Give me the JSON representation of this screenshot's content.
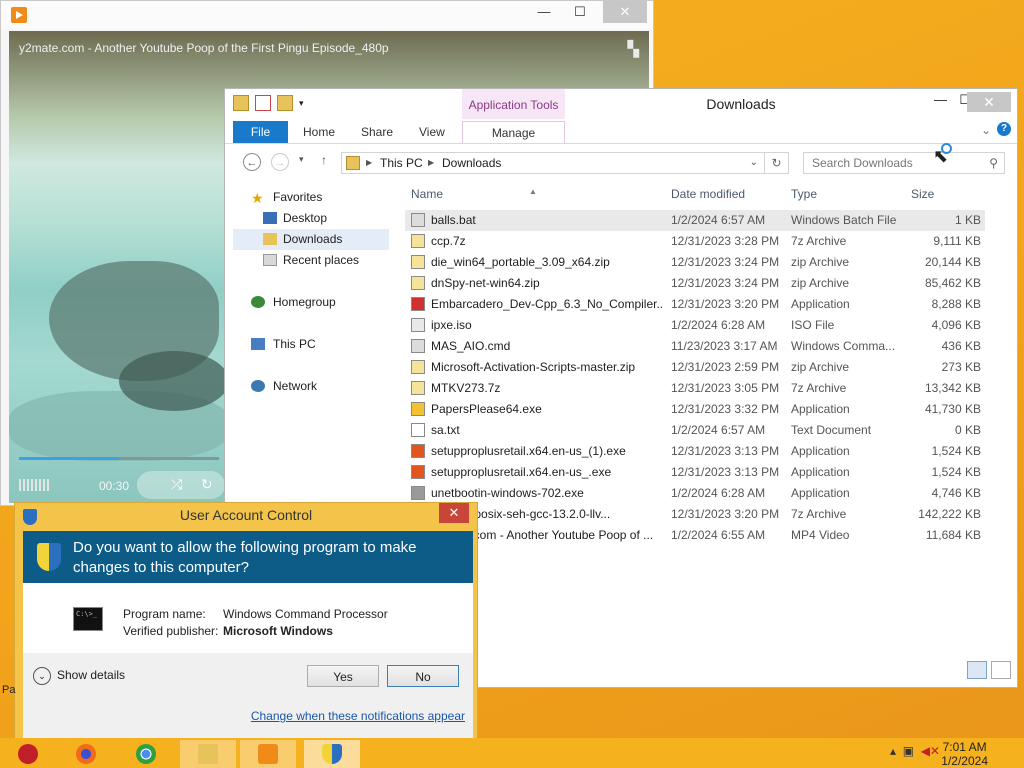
{
  "player": {
    "video_title": "y2mate.com - Another Youtube Poop of the First Pingu Episode_480p",
    "time": "00:30",
    "progress_fraction": 0.5,
    "close_label": "✕",
    "min_label": "—",
    "max_label": "☐"
  },
  "explorer": {
    "title": "Downloads",
    "context_tab": "Application Tools",
    "ribbon_tabs": [
      "File",
      "Home",
      "Share",
      "View",
      "Manage"
    ],
    "address": [
      "This PC",
      "Downloads"
    ],
    "search_placeholder": "Search Downloads",
    "nav": {
      "favorites": "Favorites",
      "desktop": "Desktop",
      "downloads": "Downloads",
      "recent": "Recent places",
      "homegroup": "Homegroup",
      "this_pc": "This PC",
      "network": "Network"
    },
    "columns": [
      "Name",
      "Date modified",
      "Type",
      "Size"
    ],
    "files": [
      {
        "name": "balls.bat",
        "date": "1/2/2024 6:57 AM",
        "type": "Windows Batch File",
        "size": "1 KB"
      },
      {
        "name": "ccp.7z",
        "date": "12/31/2023 3:28 PM",
        "type": "7z Archive",
        "size": "9,111 KB"
      },
      {
        "name": "die_win64_portable_3.09_x64.zip",
        "date": "12/31/2023 3:24 PM",
        "type": "zip Archive",
        "size": "20,144 KB"
      },
      {
        "name": "dnSpy-net-win64.zip",
        "date": "12/31/2023 3:24 PM",
        "type": "zip Archive",
        "size": "85,462 KB"
      },
      {
        "name": "Embarcadero_Dev-Cpp_6.3_No_Compiler...",
        "date": "12/31/2023 3:20 PM",
        "type": "Application",
        "size": "8,288 KB"
      },
      {
        "name": "ipxe.iso",
        "date": "1/2/2024 6:28 AM",
        "type": "ISO File",
        "size": "4,096 KB"
      },
      {
        "name": "MAS_AIO.cmd",
        "date": "11/23/2023 3:17 AM",
        "type": "Windows Comma...",
        "size": "436 KB"
      },
      {
        "name": "Microsoft-Activation-Scripts-master.zip",
        "date": "12/31/2023 2:59 PM",
        "type": "zip Archive",
        "size": "273 KB"
      },
      {
        "name": "MTKV273.7z",
        "date": "12/31/2023 3:05 PM",
        "type": "7z Archive",
        "size": "13,342 KB"
      },
      {
        "name": "PapersPlease64.exe",
        "date": "12/31/2023 3:32 PM",
        "type": "Application",
        "size": "41,730 KB"
      },
      {
        "name": "sa.txt",
        "date": "1/2/2024 6:57 AM",
        "type": "Text Document",
        "size": "0 KB"
      },
      {
        "name": "setupproplusretail.x64.en-us_(1).exe",
        "date": "12/31/2023 3:13 PM",
        "type": "Application",
        "size": "1,524 KB"
      },
      {
        "name": "setupproplusretail.x64.en-us_.exe",
        "date": "12/31/2023 3:13 PM",
        "type": "Application",
        "size": "1,524 KB"
      },
      {
        "name": "unetbootin-windows-702.exe",
        "date": "1/2/2024 6:28 AM",
        "type": "Application",
        "size": "4,746 KB"
      },
      {
        "name": "x86_64-posix-seh-gcc-13.2.0-llv...",
        "date": "12/31/2023 3:20 PM",
        "type": "7z Archive",
        "size": "142,222 KB"
      },
      {
        "name": "y2mate.com - Another Youtube Poop of ...",
        "date": "1/2/2024 6:55 AM",
        "type": "MP4 Video",
        "size": "11,684 KB"
      }
    ]
  },
  "uac": {
    "title": "User Account Control",
    "question": "Do you want to allow the following program to make changes to this computer?",
    "program_label": "Program name:",
    "program_value": "Windows Command Processor",
    "publisher_label": "Verified publisher:",
    "publisher_value": "Microsoft Windows",
    "show_details": "Show details",
    "yes": "Yes",
    "no": "No",
    "link": "Change when these notifications appear"
  },
  "taskbar": {
    "time": "7:01 AM",
    "date": "1/2/2024"
  },
  "desktop": {
    "partial_text": "Pa"
  }
}
